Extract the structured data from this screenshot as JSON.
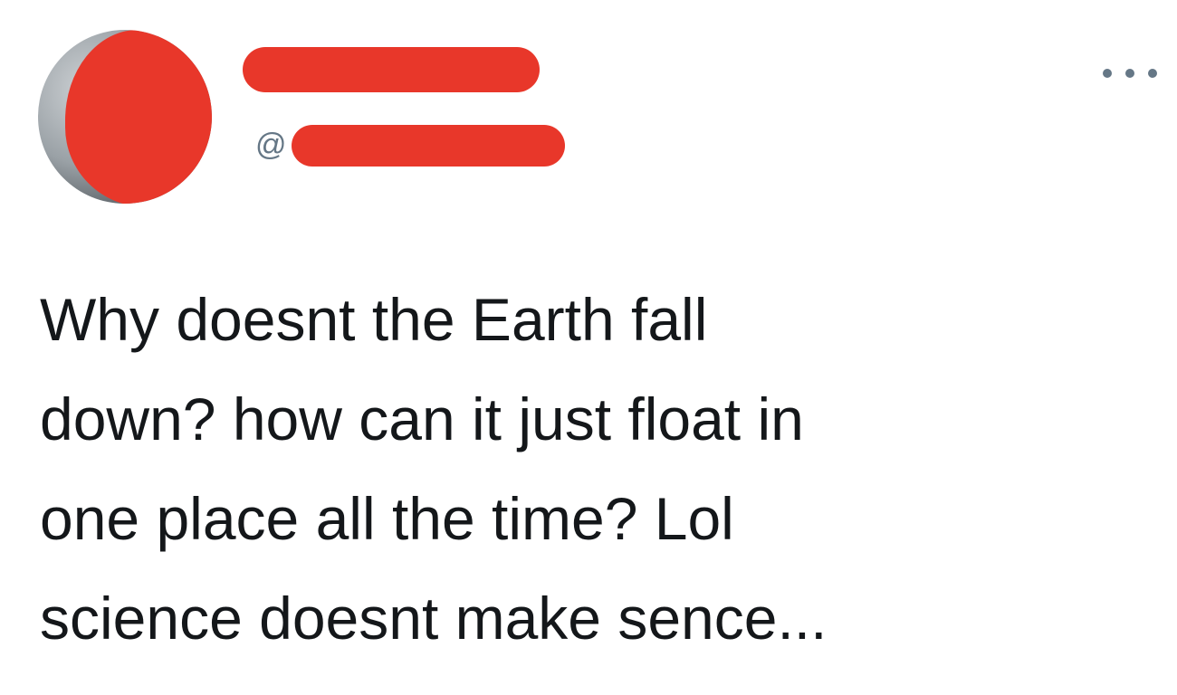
{
  "author": {
    "display_name": "",
    "handle_prefix": "@",
    "handle": "",
    "redaction_color": "#e8372a"
  },
  "icons": {
    "more": "more-horizontal-icon"
  },
  "tweet": {
    "lines": [
      "Why doesnt the Earth fall",
      "down? how can it just float in",
      "one place all the time? Lol",
      "science doesnt make sence..."
    ]
  }
}
